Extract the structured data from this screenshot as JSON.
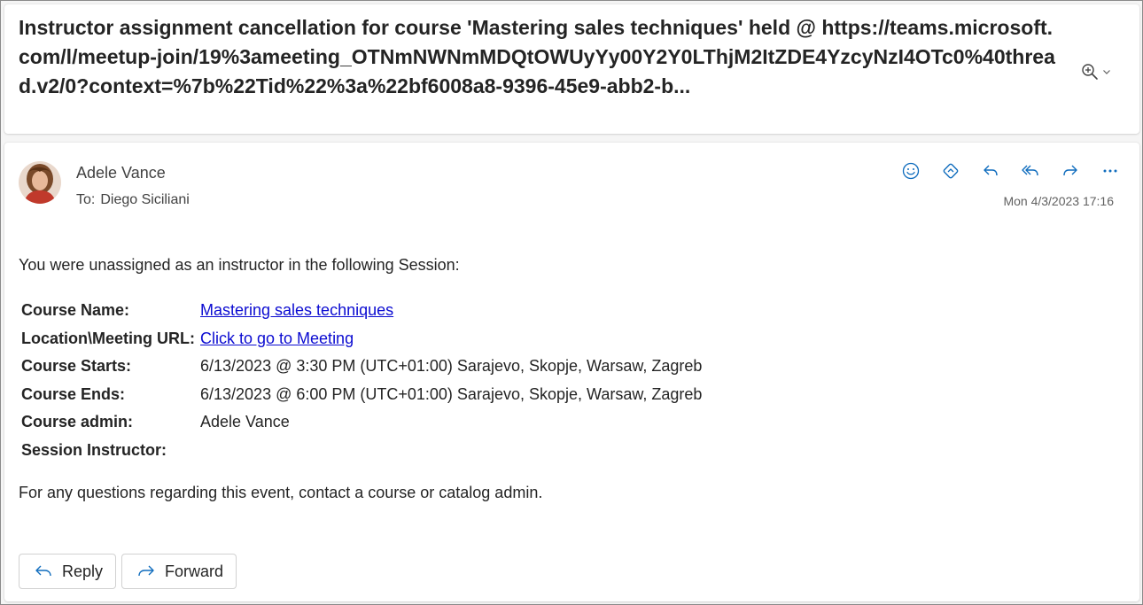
{
  "subject": "Instructor assignment cancellation for course 'Mastering sales techniques' held @ https://teams.microsoft.com/l/meetup-join/19%3ameeting_OTNmNWNmMDQtOWUyYy00Y2Y0LThjM2ItZDE4YzcyNzI4OTc0%40thread.v2/0?context=%7b%22Tid%22%3a%22bf6008a8-9396-45e9-abb2-b...",
  "header": {
    "sender": "Adele Vance",
    "to_label": "To:",
    "recipient": "Diego Siciliani",
    "date": "Mon 4/3/2023 17:16"
  },
  "icons": {
    "zoom": "zoom-in-icon",
    "emoji": "emoji-icon",
    "loop": "loop-icon",
    "reply": "reply-icon",
    "reply_all": "reply-all-icon",
    "forward": "forward-icon",
    "more": "more-icon"
  },
  "body": {
    "intro": "You were unassigned as an instructor in the following Session:",
    "rows": [
      {
        "key": "Course Name:",
        "value": "Mastering sales techniques",
        "link": true
      },
      {
        "key": "Location\\Meeting URL:",
        "value": "Click to go to Meeting",
        "link": true
      },
      {
        "key": "Course Starts:",
        "value": "6/13/2023 @ 3:30 PM (UTC+01:00) Sarajevo, Skopje, Warsaw, Zagreb",
        "link": false
      },
      {
        "key": "Course Ends:",
        "value": "6/13/2023 @ 6:00 PM (UTC+01:00) Sarajevo, Skopje, Warsaw, Zagreb",
        "link": false
      },
      {
        "key": "Course admin:",
        "value": "Adele Vance",
        "link": false
      },
      {
        "key": "Session Instructor:",
        "value": "",
        "link": false
      }
    ],
    "outro": "For any questions regarding this event, contact a course or catalog admin."
  },
  "buttons": {
    "reply": "Reply",
    "forward": "Forward"
  },
  "colors": {
    "accent": "#0f6cbd",
    "link": "#0b0bd1"
  }
}
